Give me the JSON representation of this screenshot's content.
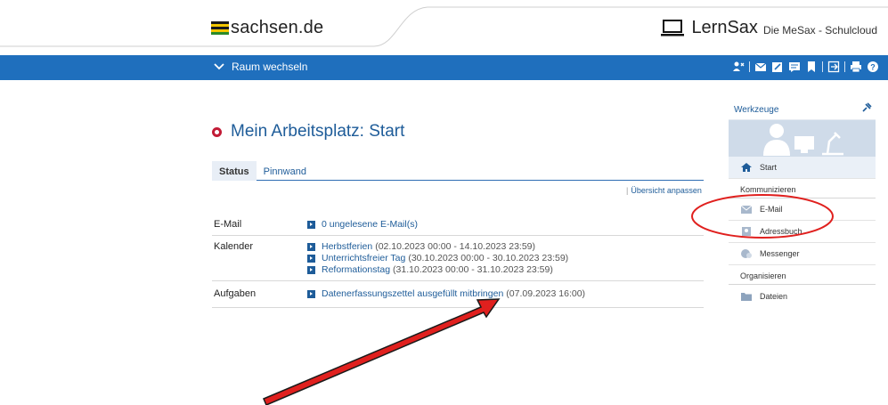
{
  "header": {
    "sachsen_logo": "sachsen.de",
    "lernsax_name": "LernSax",
    "lernsax_sub": "Die MeSax - Schulcloud",
    "flag_colors": [
      "#1a1a1a",
      "#f2c600",
      "#1a1a1a",
      "#f2c600",
      "#2a8a2a"
    ]
  },
  "topbar": {
    "room_switch": "Raum wechseln",
    "bg_color": "#1f6fbd",
    "icons": [
      "user-add-icon",
      "mail-icon",
      "edit-icon",
      "message-icon",
      "bookmark-icon",
      "logout-icon",
      "print-icon",
      "help-icon"
    ]
  },
  "main": {
    "title": "Mein Arbeitsplatz: Start",
    "tabs": [
      {
        "label": "Status",
        "active": true
      },
      {
        "label": "Pinnwand",
        "active": false
      }
    ],
    "customize_link": "Übersicht anpassen",
    "rows": [
      {
        "label": "E-Mail",
        "items": [
          {
            "link": "0 ungelesene E-Mail(s)",
            "detail": ""
          }
        ]
      },
      {
        "label": "Kalender",
        "items": [
          {
            "link": "Herbstferien",
            "detail": "(02.10.2023 00:00 - 14.10.2023 23:59)"
          },
          {
            "link": "Unterrichtsfreier Tag",
            "detail": "(30.10.2023 00:00 - 30.10.2023 23:59)"
          },
          {
            "link": "Reformationstag",
            "detail": "(31.10.2023 00:00 - 31.10.2023 23:59)"
          }
        ]
      },
      {
        "label": "Aufgaben",
        "items": [
          {
            "link": "Datenerfassungszettel ausgefüllt mitbringen",
            "detail": "(07.09.2023 16:00)"
          }
        ]
      }
    ]
  },
  "sidebar": {
    "heading": "Werkzeuge",
    "start": "Start",
    "section_communicate": "Kommunizieren",
    "email": "E-Mail",
    "addressbook": "Adressbuch",
    "messenger": "Messenger",
    "section_organize": "Organisieren",
    "files": "Dateien"
  },
  "annotations": {
    "circle_color": "#e0201e",
    "arrow_color": "#e0201e"
  }
}
